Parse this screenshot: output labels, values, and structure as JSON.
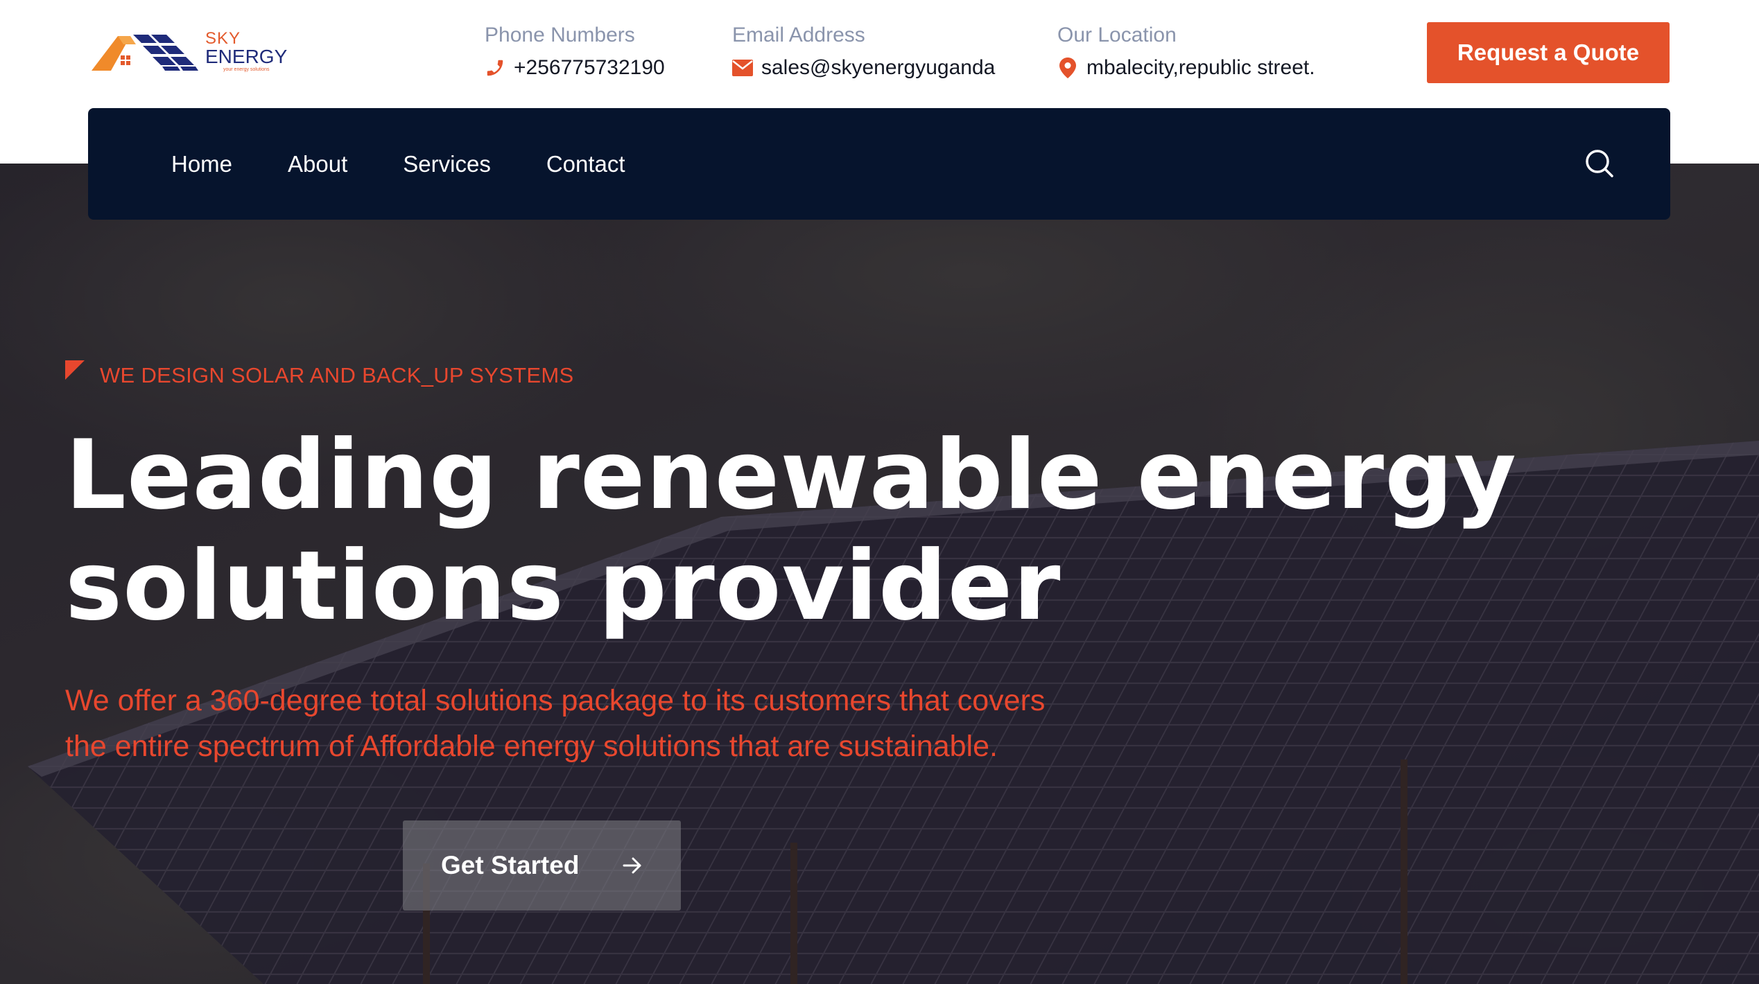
{
  "brand": {
    "name_line1": "SKY",
    "name_line2": "ENERGY",
    "tagline": "your energy solutions"
  },
  "header": {
    "contacts": [
      {
        "label": "Phone Numbers",
        "value": "+256775732190",
        "icon": "phone-icon"
      },
      {
        "label": "Email Address",
        "value": "sales@skyenergyuganda",
        "icon": "envelope-icon"
      },
      {
        "label": "Our Location",
        "value": "mbalecity,republic street.",
        "icon": "map-pin-icon"
      }
    ],
    "quote_button": "Request a Quote"
  },
  "nav": {
    "items": [
      {
        "label": "Home"
      },
      {
        "label": "About"
      },
      {
        "label": "Services"
      },
      {
        "label": "Contact"
      }
    ],
    "search_icon": "search-icon"
  },
  "hero": {
    "tagline": "WE DESIGN SOLAR AND BACK_UP SYSTEMS",
    "headline_line1": "Leading renewable energy",
    "headline_line2": "solutions provider",
    "subtext_line1": "We offer a 360-degree total solutions package to its customers that covers",
    "subtext_line2": "the entire spectrum of Affordable energy solutions that are sustainable.",
    "cta_label": "Get Started",
    "cta_icon": "arrow-right-icon"
  },
  "colors": {
    "accent": "#e4522b",
    "accent_text": "#e8472e",
    "nav_bg": "#06142d",
    "label_gray": "#8a94ac",
    "brand_blue": "#1f2b7a"
  }
}
